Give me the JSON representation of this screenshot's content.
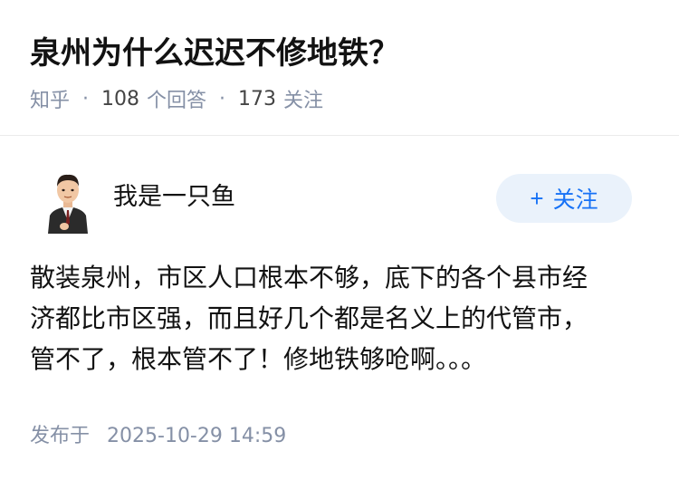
{
  "question": {
    "title": "泉州为什么迟迟不修地铁？",
    "source": "知乎",
    "answer_count": "108",
    "answer_label": "个回答",
    "follower_count": "173",
    "follower_label": "关注",
    "separator": "·"
  },
  "answer": {
    "author": {
      "name": "我是一只鱼",
      "avatar_icon": "person-avatar-icon"
    },
    "follow_button": {
      "icon": "plus-icon",
      "plus": "+",
      "label": "关注",
      "color": "#1772f6",
      "background": "#eaf2fb"
    },
    "content_lines": [
      "散装泉州，市区人口根本不够，底下的各个县市经",
      "济都比市区强，而且好几个都是名义上的代管市，",
      "管不了，根本管不了！修地铁够呛啊。。。"
    ],
    "publish_label": "发布于",
    "publish_time": "2025-10-29 14:59"
  },
  "colors": {
    "text_primary": "#121212",
    "text_secondary": "#8590a6",
    "accent": "#1772f6",
    "divider": "#ebebeb"
  }
}
